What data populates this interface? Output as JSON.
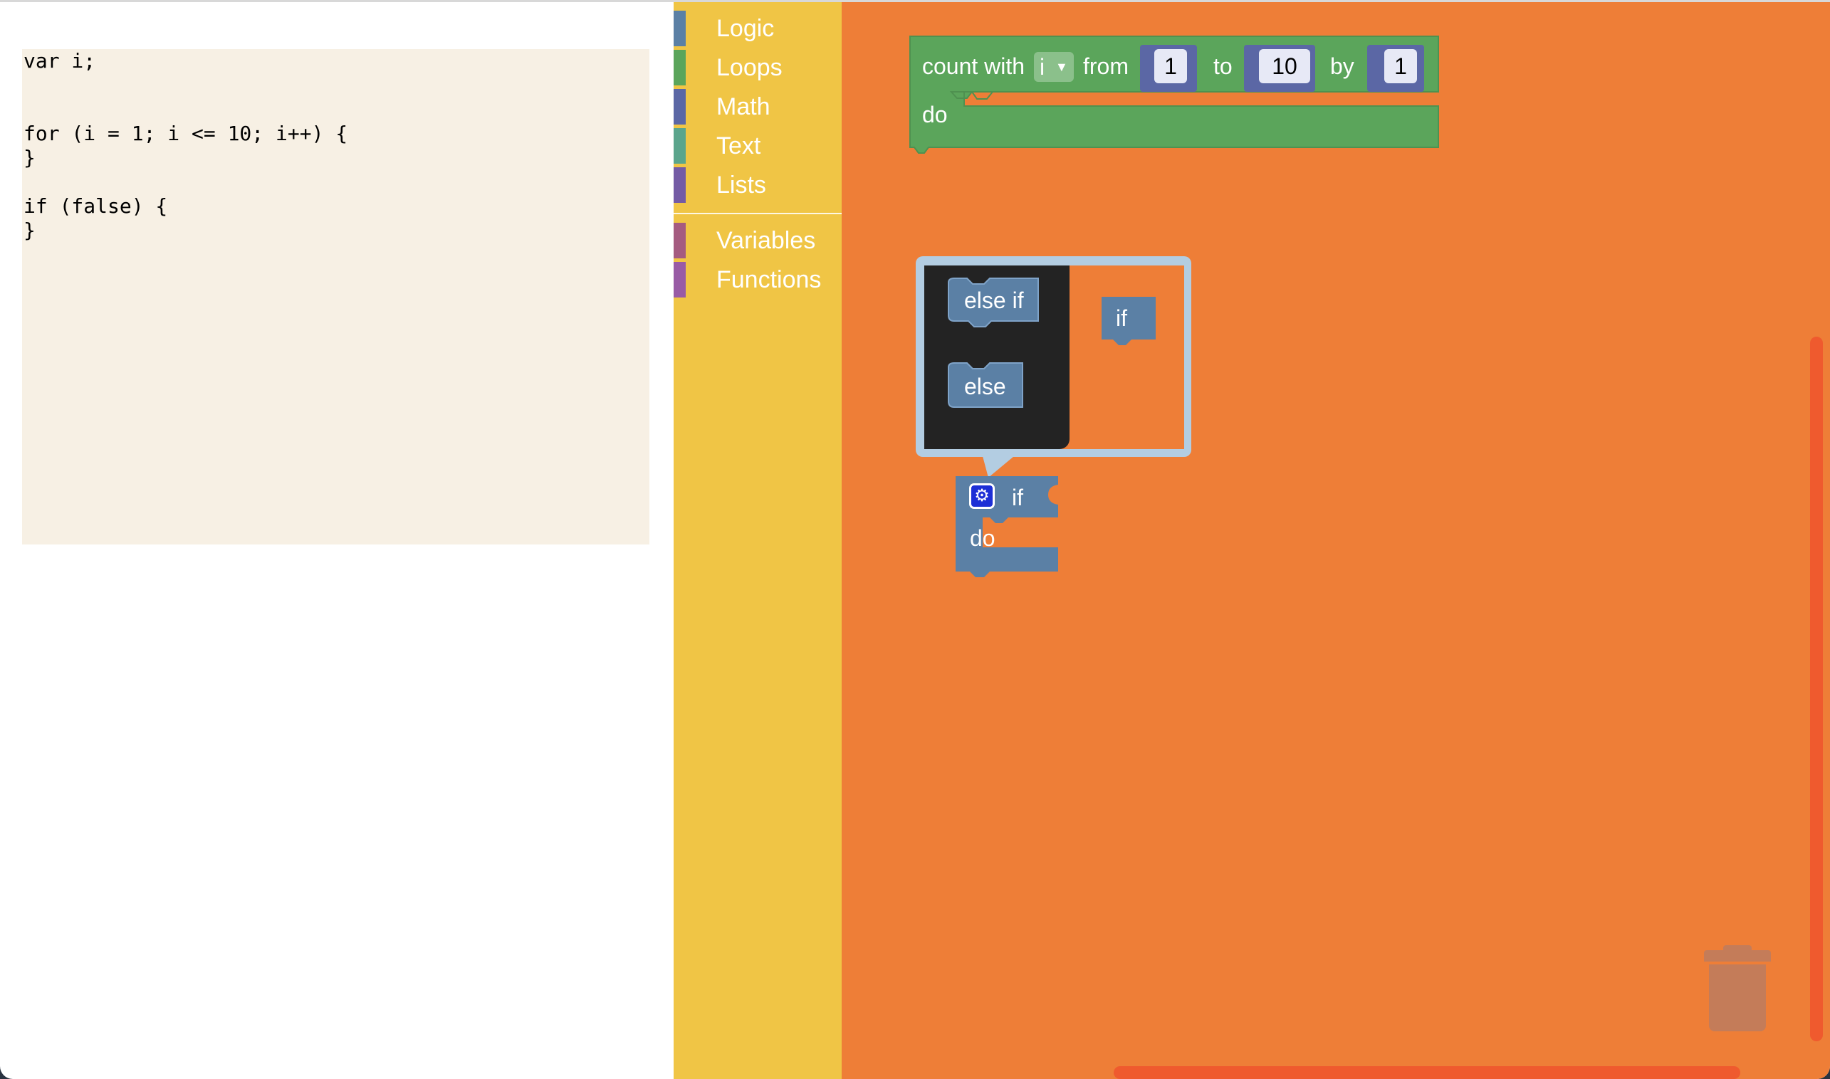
{
  "code": {
    "lines": [
      "var i;",
      "",
      "",
      "for (i = 1; i <= 10; i++) {",
      "}",
      "",
      "if (false) {",
      "}"
    ]
  },
  "toolbox": {
    "categories": [
      {
        "label": "Logic",
        "color": "#5b80a5"
      },
      {
        "label": "Loops",
        "color": "#5ba55b"
      },
      {
        "label": "Math",
        "color": "#5b67a5"
      },
      {
        "label": "Text",
        "color": "#5ba58c"
      },
      {
        "label": "Lists",
        "color": "#745ba5"
      },
      {
        "label": "Variables",
        "color": "#a55b80"
      },
      {
        "label": "Functions",
        "color": "#995ba5"
      }
    ]
  },
  "loop_block": {
    "count_with": "count with",
    "variable": "i",
    "from": "from",
    "from_value": "1",
    "to": "to",
    "to_value": "10",
    "by": "by",
    "by_value": "1",
    "do": "do",
    "color": "#5ba55b"
  },
  "mutator": {
    "else_if": "else if",
    "else": "else",
    "if": "if"
  },
  "if_block": {
    "if": "if",
    "do": "do",
    "color": "#5b80a5",
    "gear": "gear-icon"
  },
  "colors": {
    "workspace": "#ee7e37",
    "toolbox": "#f0c545",
    "code_bg": "#f7f0e4"
  }
}
